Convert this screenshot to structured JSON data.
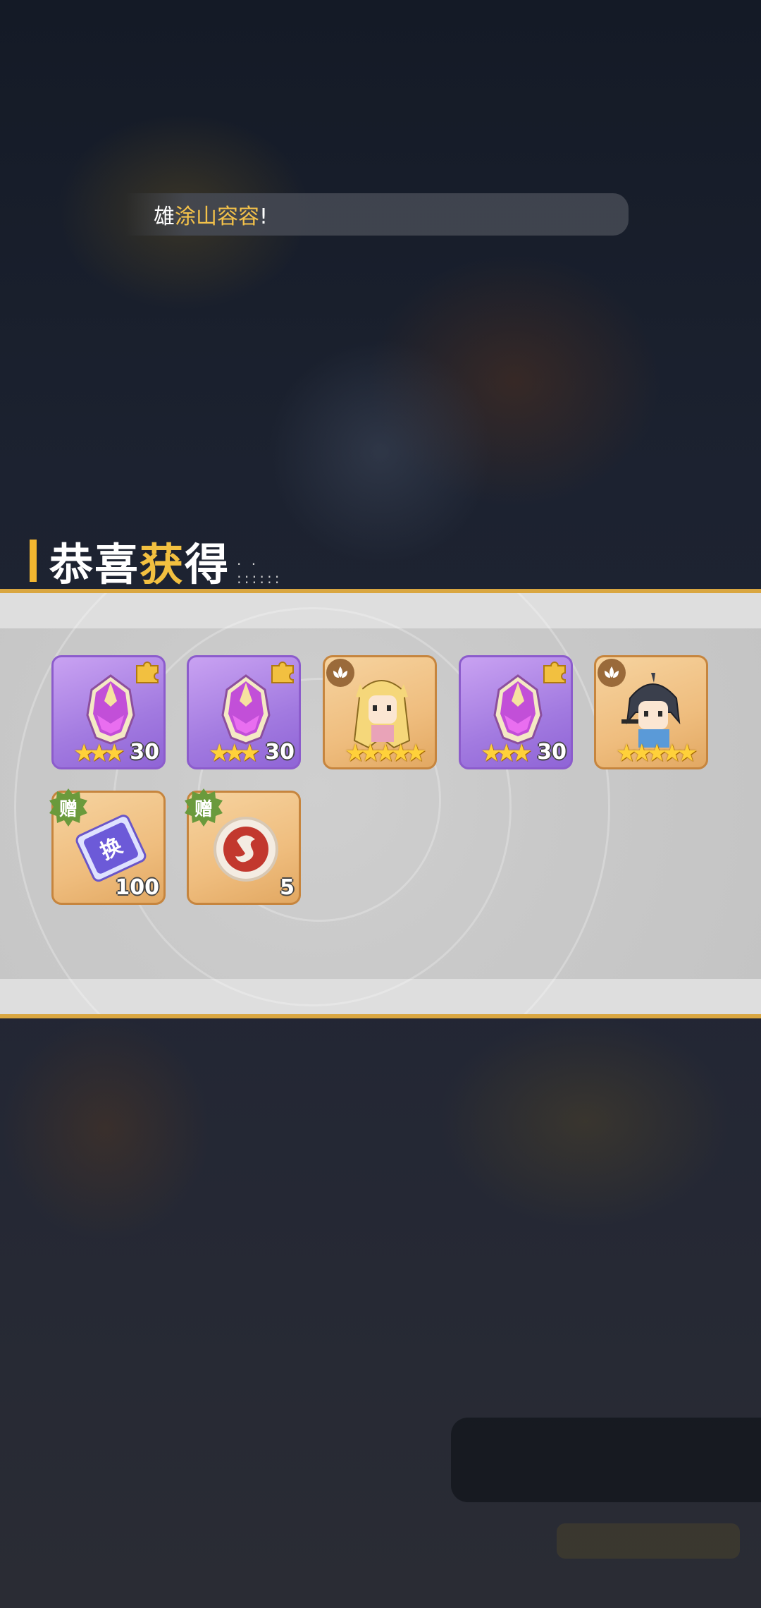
{
  "banner": {
    "prefix": "雄",
    "highlight": "涂山容容",
    "suffix": "!"
  },
  "reward_title": {
    "part1": "恭喜",
    "part2_highlight": "获",
    "part3": "得"
  },
  "items": [
    {
      "kind": "equipment-helmet",
      "stars": "★★★",
      "count": "30",
      "frame": "purple",
      "badge": "puzzle-piece-icon"
    },
    {
      "kind": "equipment-helmet",
      "stars": "★★★",
      "count": "30",
      "frame": "purple",
      "badge": "puzzle-piece-icon"
    },
    {
      "kind": "hero-blonde-girl",
      "stars": "★★★★★",
      "count": "",
      "frame": "orange",
      "badge": "lotus-icon"
    },
    {
      "kind": "equipment-helmet",
      "stars": "★★★",
      "count": "30",
      "frame": "purple",
      "badge": "puzzle-piece-icon"
    },
    {
      "kind": "hero-dark-hair-boy",
      "stars": "★★★★★",
      "count": "",
      "frame": "orange",
      "badge": "lotus-icon"
    },
    {
      "kind": "exchange-ticket",
      "stars": "",
      "count": "100",
      "frame": "orange",
      "badge": "gift-badge",
      "badge_text": "赠"
    },
    {
      "kind": "dragon-token",
      "stars": "",
      "count": "5",
      "frame": "orange",
      "badge": "gift-badge",
      "badge_text": "赠"
    }
  ],
  "ticket_label": "换",
  "colors": {
    "accent_gold": "#f2b630",
    "highlight_text": "#f4c24a",
    "gift_badge_green": "#6a9a3c",
    "purple_frame": "#8c5ccc",
    "orange_frame": "#c6853e"
  }
}
